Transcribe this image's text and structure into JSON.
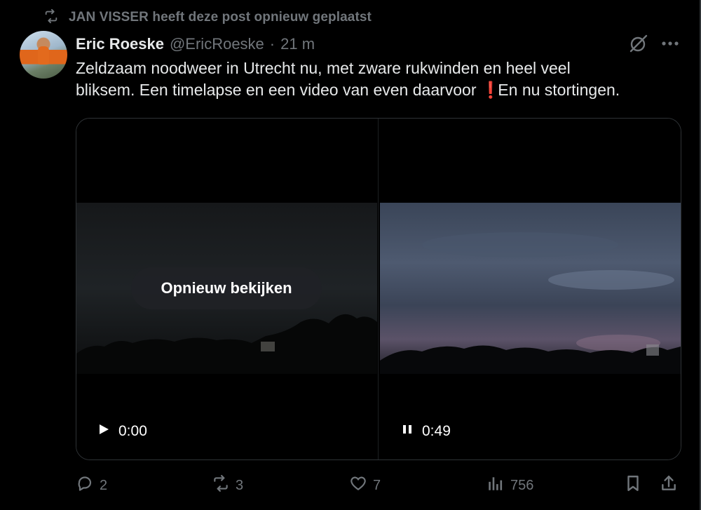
{
  "repost_banner": {
    "text": "JAN VISSER heeft deze post opnieuw geplaatst",
    "icon": "repost-icon"
  },
  "post": {
    "author_name": "Eric Roeske",
    "author_handle": "@EricRoeske",
    "separator": "·",
    "time": "21 m",
    "text_line1": "Zeldzaam noodweer in Utrecht nu, met zware rukwinden en heel veel",
    "text_line2_part1": "bliksem. Een timelapse en een video van even daarvoor",
    "emoji": "❗",
    "text_line2_part2": " En nu stortingen."
  },
  "media": {
    "left_video": {
      "replay_label": "Opnieuw bekijken",
      "play_state_icon": "play-icon",
      "time": "0:00"
    },
    "right_video": {
      "play_state_icon": "pause-icon",
      "time": "0:49"
    }
  },
  "actions": {
    "replies": "2",
    "reposts": "3",
    "likes": "7",
    "views": "756"
  },
  "colors": {
    "background": "#000000",
    "text_primary": "#e7e9ea",
    "text_secondary": "#71767b",
    "border": "#2f3336",
    "alert_red": "#e0162b"
  }
}
